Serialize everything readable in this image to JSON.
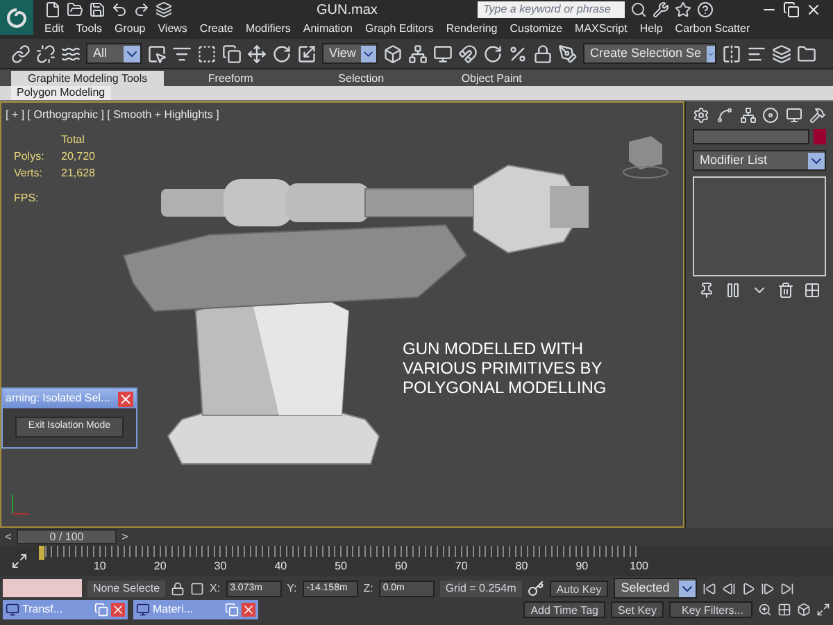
{
  "title_bar": {
    "title": "GUN.max",
    "search": {
      "placeholder": "Type a keyword or phrase"
    }
  },
  "menu": [
    "Edit",
    "Tools",
    "Group",
    "Views",
    "Create",
    "Modifiers",
    "Animation",
    "Graph Editors",
    "Rendering",
    "Customize",
    "MAXScript",
    "Help",
    "Carbon Scatter"
  ],
  "toolbar": {
    "selection_filter": "All",
    "reference_coordinate": "View",
    "named_selection": "Create Selection Se"
  },
  "ribbon": {
    "tabs": [
      {
        "label": "Graphite Modeling Tools",
        "selected": true
      },
      {
        "label": "Freeform",
        "selected": false
      },
      {
        "label": "Selection",
        "selected": false
      },
      {
        "label": "Object Paint",
        "selected": false
      }
    ],
    "panel": "Polygon Modeling"
  },
  "viewport": {
    "label": "[ + ] [ Orthographic ] [ Smooth + Highlights ]",
    "stats": {
      "header": "Total",
      "rows": [
        {
          "label": "Polys:",
          "value": "20,720"
        },
        {
          "label": "Verts:",
          "value": "21,628"
        }
      ],
      "fps": "FPS:"
    },
    "caption": "GUN MODELLED WITH VARIOUS PRIMITIVES BY POLYGONAL MODELLING"
  },
  "warning_dialog": {
    "title": "arning: Isolated Sel...",
    "button": "Exit Isolation Mode"
  },
  "command_panel": {
    "modifier_list": "Modifier List"
  },
  "time_slider": {
    "label": "0 / 100",
    "prev": "<",
    "next": ">"
  },
  "track_bar": {
    "ticks": [
      "10",
      "20",
      "30",
      "40",
      "50",
      "60",
      "70",
      "80",
      "90",
      "100"
    ]
  },
  "status": {
    "selection": "None Selecte",
    "coords": [
      {
        "label": "X:",
        "value": "3.073m"
      },
      {
        "label": "Y:",
        "value": "-14.158m"
      },
      {
        "label": "Z:",
        "value": "0.0m"
      }
    ],
    "grid": "Grid = 0.254m",
    "add_time_tag": "Add Time Tag",
    "auto_key": "Auto Key",
    "set_key": "Set Key",
    "key_mode": "Selected",
    "key_filters": "Key Filters..."
  },
  "taskbar": [
    {
      "label": "Transf..."
    },
    {
      "label": "Materi..."
    }
  ]
}
